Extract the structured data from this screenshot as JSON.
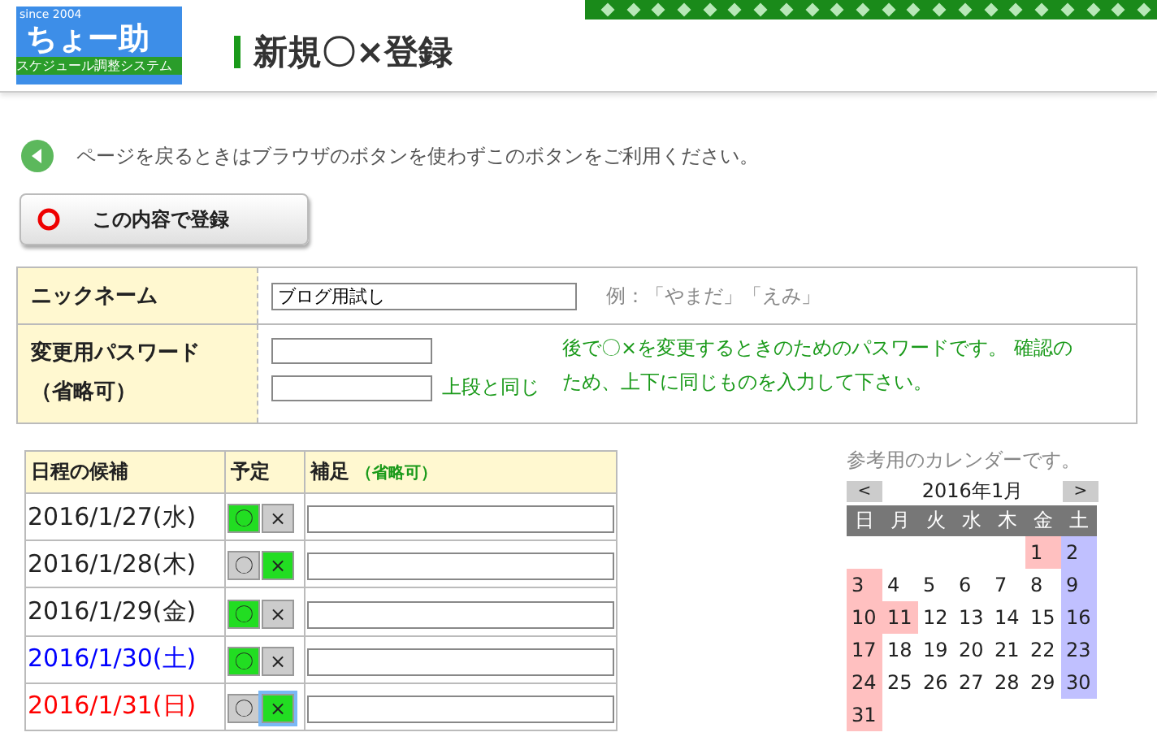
{
  "logo": {
    "since": "since 2004",
    "name": "ちょー助",
    "tagline": "スケジュール調整システム"
  },
  "page_title": "新規〇×登録",
  "back_notice": "ページを戻るときはブラウザのボタンを使わずこのボタンをご利用ください。",
  "register_button": "この内容で登録",
  "form": {
    "nickname": {
      "label": "ニックネーム",
      "value": "ブログ用試し",
      "example": "例：「やまだ」「えみ」"
    },
    "password": {
      "label": "変更用パスワード",
      "label_note": "（省略可）",
      "confirm_note": "上段と同じ",
      "help": "後で〇×を変更するときのためのパスワードです。 確認のため、上下に同じものを入力して下さい。"
    }
  },
  "candidates": {
    "columns": [
      {
        "label": "日程の候補"
      },
      {
        "label": "予定"
      },
      {
        "label": "補足",
        "note": "（省略可）"
      }
    ],
    "rows": [
      {
        "date": "2016/1/27(水)",
        "color": "#222222",
        "options": [
          {
            "label": "〇",
            "selected": true
          },
          {
            "label": "×",
            "selected": false
          }
        ]
      },
      {
        "date": "2016/1/28(木)",
        "color": "#222222",
        "options": [
          {
            "label": "〇",
            "selected": false
          },
          {
            "label": "×",
            "selected": true
          }
        ]
      },
      {
        "date": "2016/1/29(金)",
        "color": "#222222",
        "options": [
          {
            "label": "〇",
            "selected": true
          },
          {
            "label": "×",
            "selected": false
          }
        ]
      },
      {
        "date": "2016/1/30(土)",
        "color": "#0000ff",
        "options": [
          {
            "label": "〇",
            "selected": true
          },
          {
            "label": "×",
            "selected": false
          }
        ]
      },
      {
        "date": "2016/1/31(日)",
        "color": "#ff0000",
        "options": [
          {
            "label": "〇",
            "selected": false
          },
          {
            "label": "×",
            "selected": true,
            "focused": true
          }
        ]
      }
    ]
  },
  "calendar": {
    "caption": "参考用のカレンダーです。",
    "prev": "<",
    "month": "2016年1月",
    "next": ">",
    "weekdays": [
      "日",
      "月",
      "火",
      "水",
      "木",
      "金",
      "土"
    ],
    "weeks": [
      [
        {
          "day": "1",
          "kind": "holiday"
        },
        {
          "day": "2",
          "kind": "saturday"
        }
      ],
      [
        {
          "day": "3",
          "kind": "sunday"
        },
        {
          "day": "4",
          "kind": "weekday"
        },
        {
          "day": "5",
          "kind": "weekday"
        },
        {
          "day": "6",
          "kind": "weekday"
        },
        {
          "day": "7",
          "kind": "weekday"
        },
        {
          "day": "8",
          "kind": "weekday"
        },
        {
          "day": "9",
          "kind": "saturday"
        }
      ],
      [
        {
          "day": "10",
          "kind": "sunday"
        },
        {
          "day": "11",
          "kind": "holiday"
        },
        {
          "day": "12",
          "kind": "weekday"
        },
        {
          "day": "13",
          "kind": "weekday"
        },
        {
          "day": "14",
          "kind": "weekday"
        },
        {
          "day": "15",
          "kind": "weekday"
        },
        {
          "day": "16",
          "kind": "saturday"
        }
      ],
      [
        {
          "day": "17",
          "kind": "sunday"
        },
        {
          "day": "18",
          "kind": "weekday"
        },
        {
          "day": "19",
          "kind": "weekday"
        },
        {
          "day": "20",
          "kind": "weekday"
        },
        {
          "day": "21",
          "kind": "weekday"
        },
        {
          "day": "22",
          "kind": "weekday"
        },
        {
          "day": "23",
          "kind": "saturday"
        }
      ],
      [
        {
          "day": "24",
          "kind": "sunday"
        },
        {
          "day": "25",
          "kind": "weekday"
        },
        {
          "day": "26",
          "kind": "weekday"
        },
        {
          "day": "27",
          "kind": "weekday"
        },
        {
          "day": "28",
          "kind": "weekday"
        },
        {
          "day": "29",
          "kind": "weekday"
        },
        {
          "day": "30",
          "kind": "saturday"
        }
      ],
      [
        {
          "day": "31",
          "kind": "sunday"
        }
      ]
    ]
  }
}
